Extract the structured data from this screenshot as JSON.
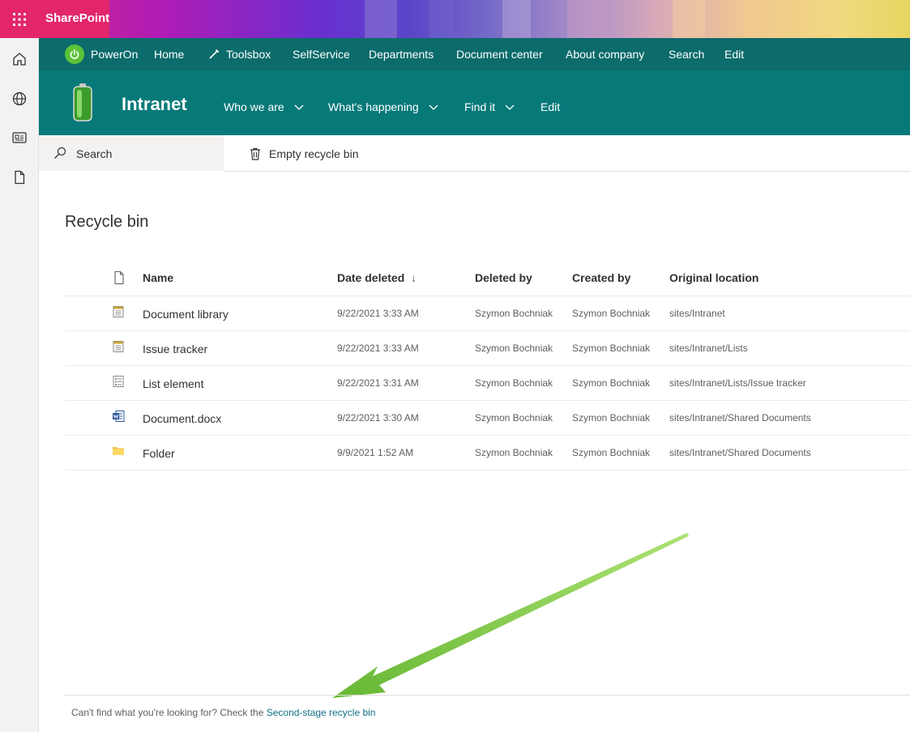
{
  "suite": {
    "brand": "SharePoint"
  },
  "hub_nav": {
    "items": [
      "PowerOn",
      "Home",
      "Toolsbox",
      "SelfService",
      "Departments",
      "Document center",
      "About company",
      "Search",
      "Edit"
    ]
  },
  "site": {
    "title": "Intranet",
    "nav": [
      "Who we are",
      "What's happening",
      "Find it",
      "Edit"
    ]
  },
  "command_bar": {
    "search_placeholder": "Search",
    "empty_label": "Empty recycle bin"
  },
  "page": {
    "title": "Recycle bin"
  },
  "table": {
    "columns": [
      "Name",
      "Date deleted",
      "Deleted by",
      "Created by",
      "Original location"
    ],
    "sort_indicator": "↓",
    "rows": [
      {
        "icon": "list-icon",
        "name": "Document library",
        "date": "9/22/2021 3:33 AM",
        "deleted_by": "Szymon Bochniak",
        "created_by": "Szymon Bochniak",
        "location": "sites/Intranet"
      },
      {
        "icon": "list-icon",
        "name": "Issue tracker",
        "date": "9/22/2021 3:33 AM",
        "deleted_by": "Szymon Bochniak",
        "created_by": "Szymon Bochniak",
        "location": "sites/Intranet/Lists"
      },
      {
        "icon": "list-item-icon",
        "name": "List element",
        "date": "9/22/2021 3:31 AM",
        "deleted_by": "Szymon Bochniak",
        "created_by": "Szymon Bochniak",
        "location": "sites/Intranet/Lists/Issue tracker"
      },
      {
        "icon": "word-icon",
        "name": "Document.docx",
        "date": "9/22/2021 3:30 AM",
        "deleted_by": "Szymon Bochniak",
        "created_by": "Szymon Bochniak",
        "location": "sites/Intranet/Shared Documents"
      },
      {
        "icon": "folder-icon",
        "name": "Folder",
        "date": "9/9/2021 1:52 AM",
        "deleted_by": "Szymon Bochniak",
        "created_by": "Szymon Bochniak",
        "location": "sites/Intranet/Shared Documents"
      }
    ]
  },
  "footer": {
    "text": "Can't find what you're looking for? Check the ",
    "link": "Second-stage recycle bin"
  },
  "colors": {
    "suite_accent": "#e3266b",
    "hub_nav_bg": "#0c6b6b",
    "site_header_bg": "#077979",
    "link": "#0f6e86",
    "arrow": "#7ac943"
  }
}
